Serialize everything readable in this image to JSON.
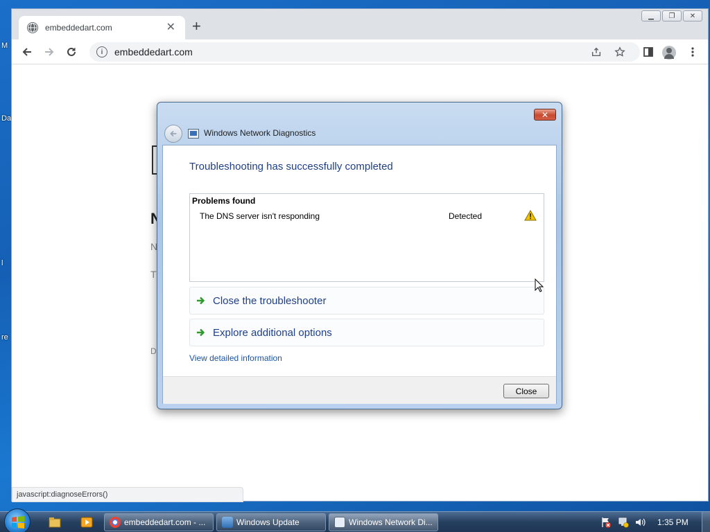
{
  "desktop": {
    "frag1": "M",
    "frag2": "Da",
    "frag3": "l",
    "frag4": "re"
  },
  "browser": {
    "tab_title": "embeddedart.com",
    "tab_close": "✕",
    "new_tab": "+",
    "url": "embeddedart.com",
    "status_text": "javascript:diagnoseErrors()",
    "window_controls": {
      "minimize": "▁",
      "restore": "❐",
      "close": "✕"
    },
    "page_fragments": [
      "N",
      "N",
      "T",
      "D"
    ]
  },
  "dialog": {
    "title": "Windows Network Diagnostics",
    "close_glyph": "✕",
    "heading": "Troubleshooting has successfully completed",
    "problems_header": "Problems found",
    "problem": {
      "name": "The DNS server isn't responding",
      "status": "Detected",
      "icon": "warning-icon"
    },
    "commands": [
      {
        "label": "Close the troubleshooter"
      },
      {
        "label": "Explore additional options"
      }
    ],
    "detail_link": "View detailed information",
    "close_button": "Close"
  },
  "taskbar": {
    "tasks": [
      {
        "label": "embeddedart.com - ..."
      },
      {
        "label": "Windows Update"
      },
      {
        "label": "Windows Network Di..."
      }
    ],
    "clock": "1:35 PM"
  },
  "colors": {
    "accent_link": "#1e3f87",
    "warning": "#f2c200"
  }
}
